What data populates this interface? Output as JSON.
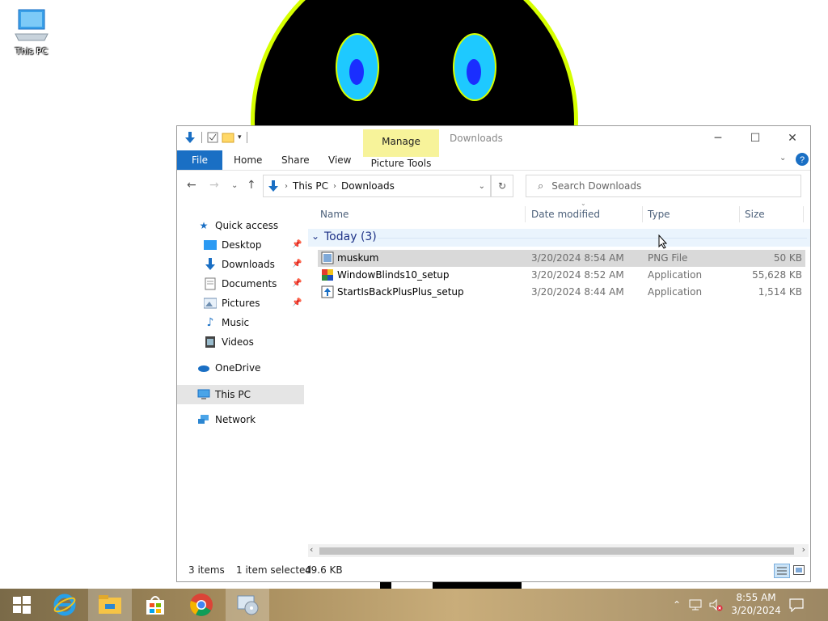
{
  "desktop": {
    "icons": [
      {
        "label": "This PC",
        "icon": "computer-icon"
      }
    ]
  },
  "window": {
    "title": "Downloads",
    "contextual_group": "Manage",
    "contextual_tab": "Picture Tools",
    "tabs": [
      "File",
      "Home",
      "Share",
      "View"
    ],
    "address": {
      "crumbs": [
        "This PC",
        "Downloads"
      ]
    },
    "search_placeholder": "Search Downloads",
    "nav": {
      "quick_access": "Quick access",
      "items": [
        {
          "label": "Desktop",
          "pinned": true
        },
        {
          "label": "Downloads",
          "pinned": true
        },
        {
          "label": "Documents",
          "pinned": true
        },
        {
          "label": "Pictures",
          "pinned": true
        },
        {
          "label": "Music",
          "pinned": false
        },
        {
          "label": "Videos",
          "pinned": false
        }
      ],
      "onedrive": "OneDrive",
      "this_pc": "This PC",
      "network": "Network"
    },
    "columns": {
      "name": "Name",
      "date": "Date modified",
      "type": "Type",
      "size": "Size"
    },
    "group": {
      "label": "Today (3)"
    },
    "files": [
      {
        "name": "muskum",
        "date": "3/20/2024 8:54 AM",
        "type": "PNG File",
        "size": "50 KB",
        "selected": true
      },
      {
        "name": "WindowBlinds10_setup",
        "date": "3/20/2024 8:52 AM",
        "type": "Application",
        "size": "55,628 KB",
        "selected": false
      },
      {
        "name": "StartIsBackPlusPlus_setup",
        "date": "3/20/2024 8:44 AM",
        "type": "Application",
        "size": "1,514 KB",
        "selected": false
      }
    ],
    "status": {
      "items": "3 items",
      "selected": "1 item selected",
      "size": "49.6 KB"
    }
  },
  "taskbar": {
    "apps": [
      "start-icon",
      "internet-explorer-icon",
      "file-explorer-icon",
      "store-icon",
      "chrome-icon",
      "setup-icon"
    ],
    "time": "8:55 AM",
    "date": "3/20/2024"
  },
  "colors": {
    "accent": "#1a6fc4",
    "selection": "#d9d9d9",
    "contextual": "#f7f39a",
    "group_text": "#1e3287"
  }
}
